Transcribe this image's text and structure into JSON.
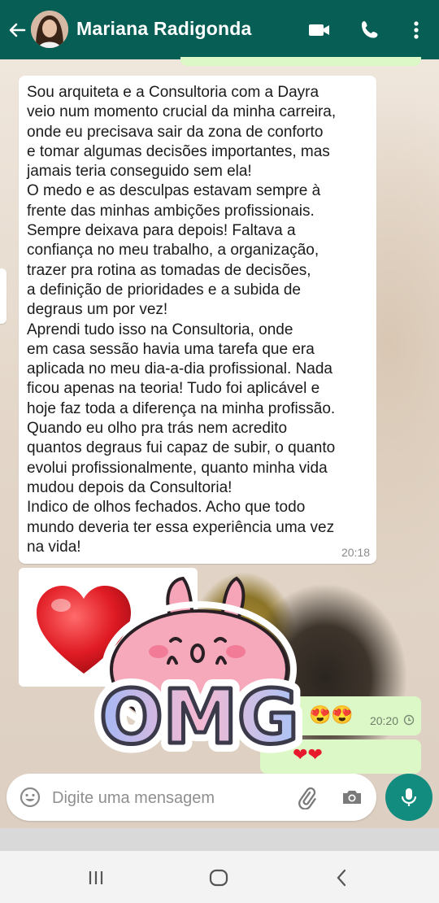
{
  "header": {
    "contact_name": "Mariana Radigonda",
    "back_icon": "arrow-left-icon",
    "video_icon": "video-call-icon",
    "call_icon": "phone-icon",
    "menu_icon": "more-vert-icon",
    "bg_color": "#075e54"
  },
  "messages": {
    "incoming_text": "Sou arquiteta e a Consultoria com a Dayra\nveio num momento crucial da minha carreira,\nonde eu precisava sair da zona de conforto\ne tomar algumas decisões importantes, mas\njamais teria conseguido sem ela!\nO medo e as desculpas estavam sempre à\nfrente das minhas ambições profissionais.\nSempre deixava para depois! Faltava a\nconfiança no meu trabalho, a organização,\ntrazer pra rotina as tomadas de decisões,\na definição de prioridades e a subida de\ndegraus um por vez!\nAprendi tudo isso na Consultoria, onde\nem casa sessão havia uma tarefa que era\naplicada no meu dia-a-dia profissional. Nada\nficou apenas na teoria! Tudo foi aplicável e\nhoje faz toda a diferença na minha profissão.\nQuando eu olho pra trás nem acredito\nquantos degraus fui capaz de subir, o quanto\nevolui profissionalmente, quanto minha vida\nmudou depois da Consultoria!\nIndico de olhos fechados. Acho que todo\nmundo deveria ter essa experiência uma vez\nna vida!",
    "incoming_time": "20:18",
    "sticker_heart": "red-heart-sticker",
    "sticker_omg_text": "OMG",
    "outgoing1_emoji": "😍😍",
    "outgoing1_time": "20:20",
    "outgoing2_emoji": "❤❤"
  },
  "composer": {
    "placeholder": "Digite uma mensagem",
    "emoji_icon": "emoji-icon",
    "attach_icon": "paperclip-icon",
    "camera_icon": "camera-icon",
    "mic_icon": "mic-icon",
    "accent": "#128c7e"
  },
  "navbar": {
    "recents_icon": "recents-icon",
    "home_icon": "home-icon",
    "back_icon": "back-chevron-icon"
  }
}
